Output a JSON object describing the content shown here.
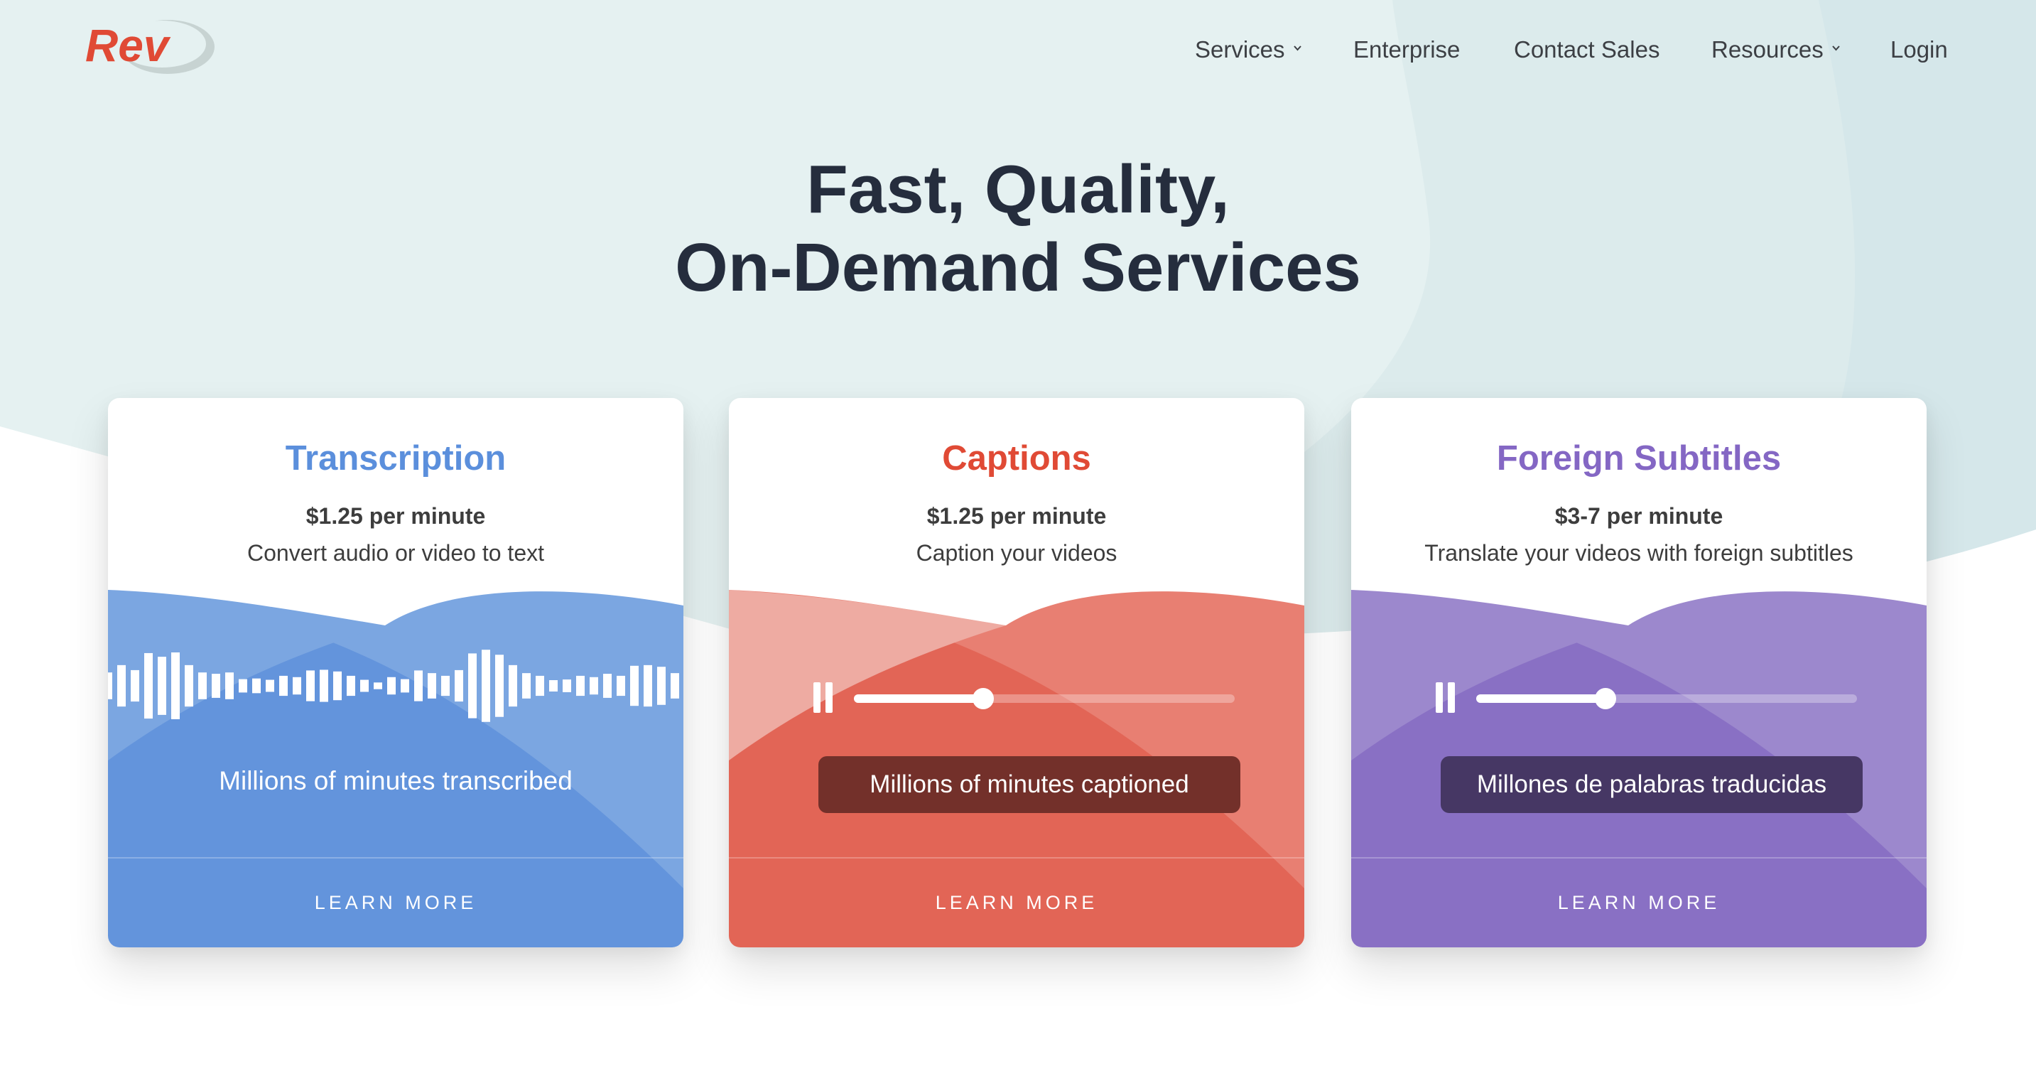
{
  "brand": {
    "logo_text": "Rev",
    "logo_color": "#e04a35",
    "swoosh_color": "#c7d3d2"
  },
  "nav": {
    "items": [
      {
        "label": "Services",
        "has_dropdown": true
      },
      {
        "label": "Enterprise",
        "has_dropdown": false
      },
      {
        "label": "Contact Sales",
        "has_dropdown": false
      },
      {
        "label": "Resources",
        "has_dropdown": true
      },
      {
        "label": "Login",
        "has_dropdown": false
      }
    ]
  },
  "hero": {
    "line1": "Fast, Quality,",
    "line2": "On-Demand Services"
  },
  "colors": {
    "bg_light": "#e5f1f1",
    "bg_mid": "#dcebec",
    "bg_dark": "#d3e6e9",
    "heading": "#252d3d",
    "body_text": "#3d3d3d"
  },
  "cards": [
    {
      "title": "Transcription",
      "price": "$1.25 per minute",
      "description": "Convert audio or video to text",
      "stat": "Millions of minutes transcribed",
      "cta": "LEARN MORE",
      "accent": "#6394dc",
      "accent_light": "#7ba6e1",
      "title_color": "#5b8fdc",
      "widget": "waveform",
      "waveform_levels": [
        0.4,
        0.62,
        0.47,
        0.98,
        0.87,
        1.0,
        0.62,
        0.4,
        0.36,
        0.4,
        0.2,
        0.22,
        0.18,
        0.3,
        0.26,
        0.46,
        0.48,
        0.43,
        0.3,
        0.18,
        0.1,
        0.26,
        0.2,
        0.46,
        0.38,
        0.3,
        0.47,
        0.97,
        1.08,
        0.93,
        0.62,
        0.38,
        0.3,
        0.17,
        0.19,
        0.3,
        0.26,
        0.36,
        0.3,
        0.6,
        0.62,
        0.57,
        0.38,
        0.25
      ]
    },
    {
      "title": "Captions",
      "price": "$1.25 per minute",
      "description": "Caption your videos",
      "stat": "Millions of minutes captioned",
      "cta": "LEARN MORE",
      "accent": "#e26556",
      "accent_light": "#e87f72",
      "accent_lighter": "#eeaba2",
      "title_color": "#e04a35",
      "stat_box_color": "#73302a",
      "widget": "player",
      "progress": 0.34
    },
    {
      "title": "Foreign Subtitles",
      "price": "$3-7 per minute",
      "description": "Translate your videos with foreign subtitles",
      "stat": "Millones de palabras traducidas",
      "cta": "LEARN MORE",
      "accent": "#8970c4",
      "accent_light": "#9c88cd",
      "title_color": "#8467c4",
      "stat_box_color": "#463764",
      "widget": "player",
      "progress": 0.34
    }
  ]
}
